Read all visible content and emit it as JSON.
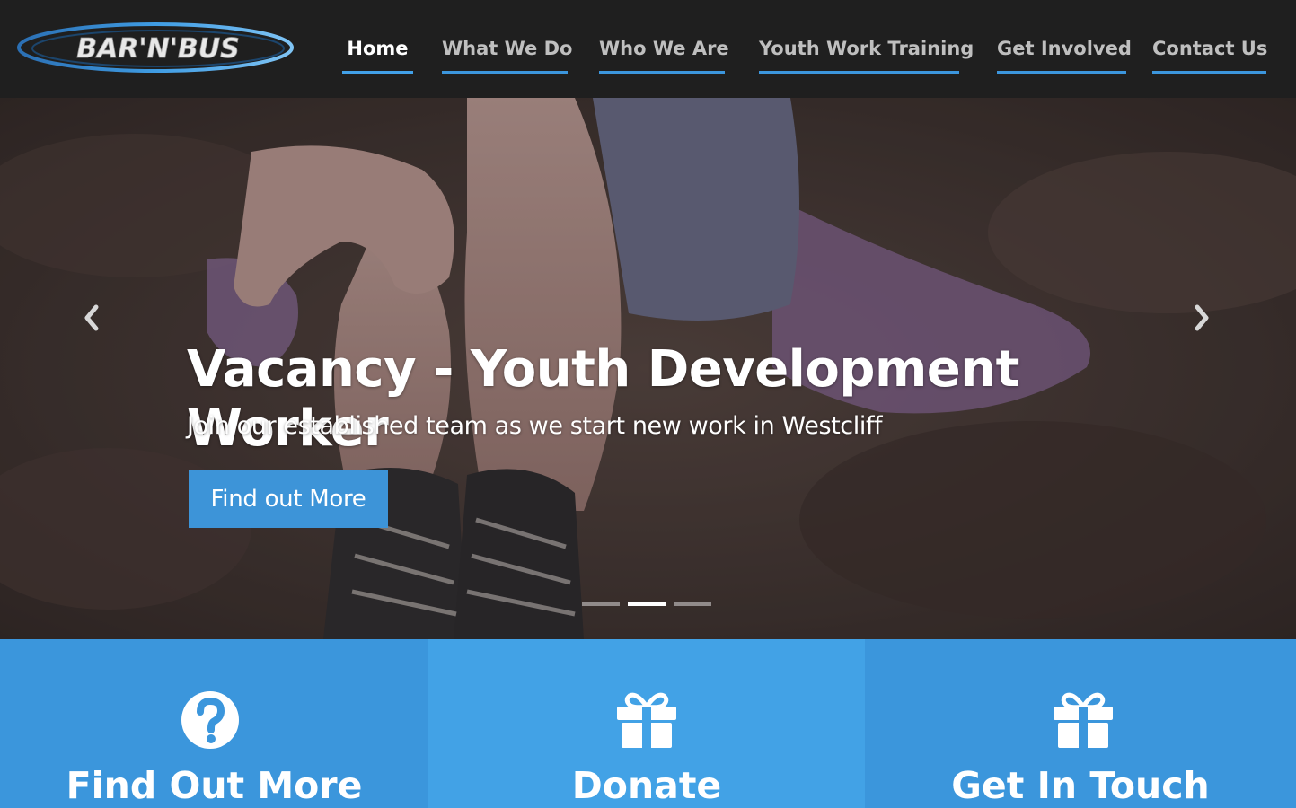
{
  "brand": {
    "logo_text": "BAR'N'BUS",
    "accent_color": "#3c96dd"
  },
  "nav": {
    "items": [
      {
        "label": "Home",
        "active": true
      },
      {
        "label": "What We Do",
        "active": false
      },
      {
        "label": "Who We Are",
        "active": false
      },
      {
        "label": "Youth Work Training",
        "active": false
      },
      {
        "label": "Get Involved",
        "active": false
      },
      {
        "label": "Contact Us",
        "active": false
      }
    ]
  },
  "hero": {
    "title": "Vacancy - Youth Development Worker",
    "subtitle": "Join our established team as we start new work in Westcliff",
    "button_label": "Find out More",
    "prev_icon": "chevron-left-icon",
    "next_icon": "chevron-right-icon",
    "slide_count": 3,
    "active_slide": 2
  },
  "features": [
    {
      "label": "Find Out More",
      "icon": "question-circle-icon"
    },
    {
      "label": "Donate",
      "icon": "gift-icon"
    },
    {
      "label": "Get In Touch",
      "icon": "gift-icon"
    }
  ]
}
